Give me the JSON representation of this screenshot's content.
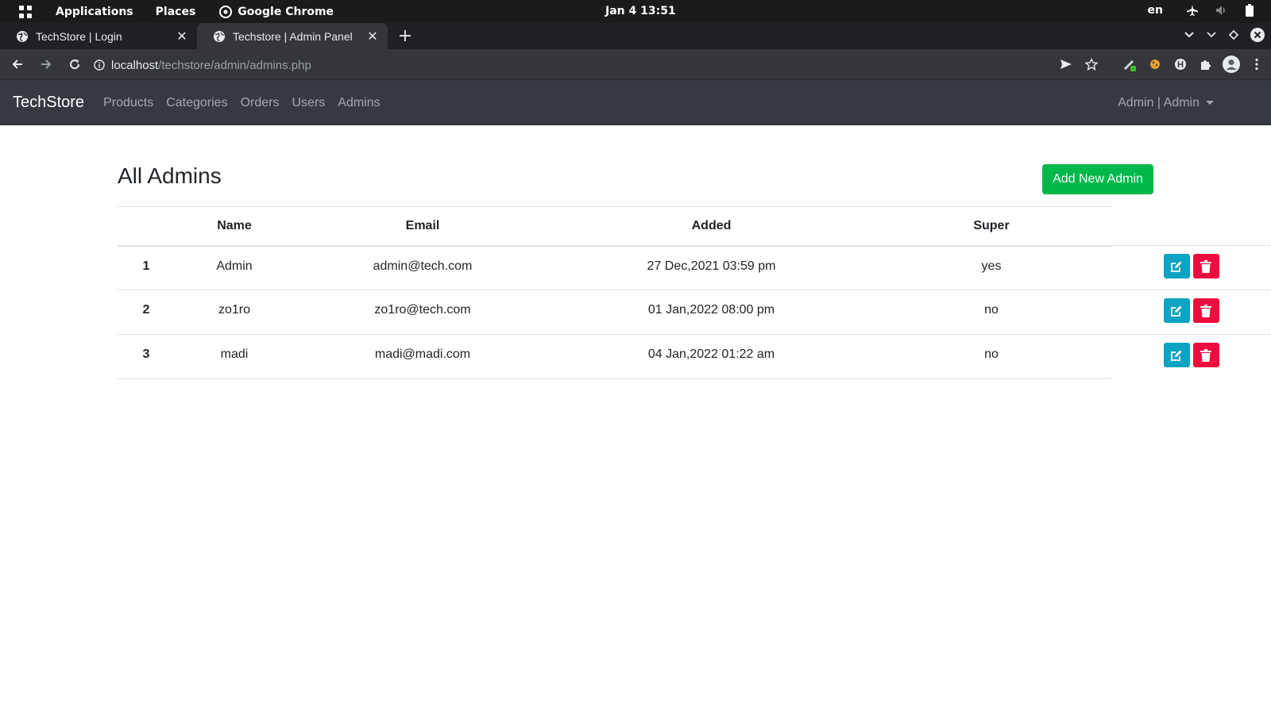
{
  "system_bar": {
    "applications": "Applications",
    "places": "Places",
    "chrome_app": "Google Chrome",
    "clock": "Jan 4  13:51",
    "language": "en"
  },
  "browser": {
    "tabs": [
      {
        "title": "TechStore | Login",
        "active": false
      },
      {
        "title": "Techstore | Admin Panel",
        "active": true
      }
    ],
    "url_host": "localhost",
    "url_path": "/techstore/admin/admins.php"
  },
  "navbar": {
    "brand": "TechStore",
    "links": [
      "Products",
      "Categories",
      "Orders",
      "Users",
      "Admins"
    ],
    "user_menu": "Admin | Admin"
  },
  "page": {
    "title": "All Admins",
    "add_button": "Add New Admin",
    "columns": [
      "",
      "Name",
      "Email",
      "Added",
      "Super"
    ],
    "rows": [
      {
        "num": "1",
        "name": "Admin",
        "email": "admin@tech.com",
        "added": "27 Dec,2021 03:59 pm",
        "super": "yes"
      },
      {
        "num": "2",
        "name": "zo1ro",
        "email": "zo1ro@tech.com",
        "added": "01 Jan,2022 08:00 pm",
        "super": "no"
      },
      {
        "num": "3",
        "name": "madi",
        "email": "madi@madi.com",
        "added": "04 Jan,2022 01:22 am",
        "super": "no"
      }
    ]
  },
  "colors": {
    "navbar_bg": "#343a40",
    "success": "#00b74a",
    "edit": "#0da3c2",
    "delete": "#ed0c3d"
  }
}
